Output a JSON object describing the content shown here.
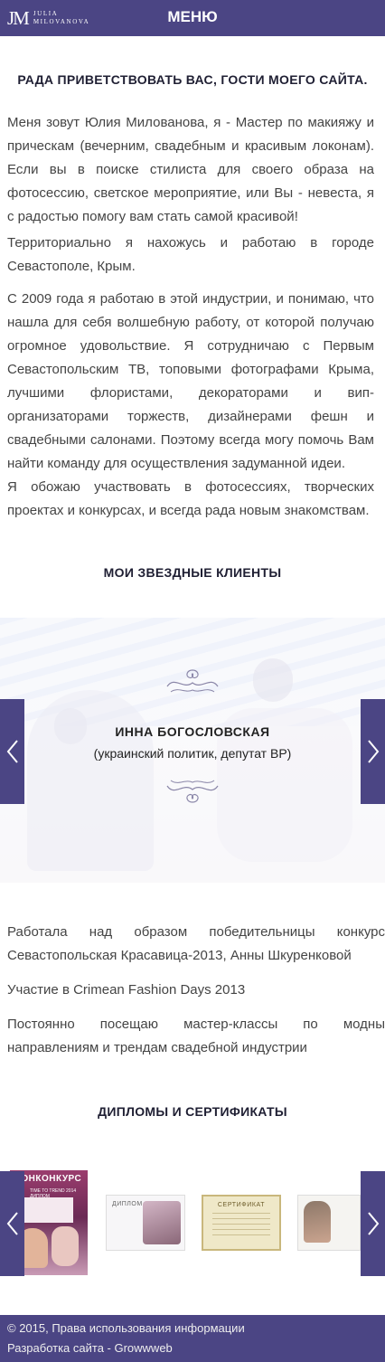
{
  "header": {
    "logo_mark": "JM",
    "logo_line1": "JULIA",
    "logo_line2": "MILOVANOVA",
    "menu_label": "МЕНЮ"
  },
  "welcome": {
    "title": "РАДА ПРИВЕТСТВОВАТЬ ВАС, ГОСТИ МОЕГО САЙТА.",
    "paragraphs": [
      "Меня зовут Юлия Милованова, я - Мастер по макияжу и прическам (вечерним, свадебным и красивым локонам). Если вы в поиске стилиста для своего образа на фотосессию, светское мероприятие, или Вы - невеста, я с радостью помогу вам стать самой красивой!",
      "Территориально я нахожусь и работаю в городе Севастополе, Крым.",
      "С 2009 года я работаю в этой индустрии, и понимаю, что нашла для себя волшебную работу, от которой получаю огромное удовольствие. Я сотрудничаю с Первым Севастопольским ТВ, топовыми фотографами Крыма, лучшими флористами, декораторами и вип-организаторами торжеств, дизайнерами фешн и свадебными салонами. Поэтому всегда могу помочь Вам найти команду для осуществления задуманной идеи.",
      "Я обожаю участвовать в фотосессиях, творческих проектах и конкурсах, и всегда рада новым знакомствам."
    ]
  },
  "clients": {
    "title": "МОИ ЗВЕЗДНЫЕ КЛИЕНТЫ",
    "slide": {
      "name": "ИННА БОГОСЛОВСКАЯ",
      "role": "(украинский политик, депутат ВР)"
    },
    "prev_icon": "chevron-left-icon",
    "next_icon": "chevron-right-icon"
  },
  "achievements": [
    "Работала над образом победительницы конкурс Севастопольская Красавица-2013, Анны Шкуренковой",
    "Участие в Crimean Fashion Days 2013",
    "Постоянно посещаю мастер-классы по модны направлениям и трендам свадебной индустрии"
  ],
  "diplomas": {
    "title": "ДИПЛОМЫ И СЕРТИФИКАТЫ",
    "items": [
      {
        "label": "ТОНКОНКУРС",
        "sub": "TIME TO TREND 2014 ДИПЛОМ"
      },
      {
        "label": "ДИПЛОМ"
      },
      {
        "label": "СЕРТИФИКАТ"
      },
      {
        "label": ""
      }
    ]
  },
  "footer": {
    "copyright": "© 2015, Права использования информации",
    "dev": "Разработка сайта - Growwweb"
  },
  "colors": {
    "brand": "#4b4584",
    "text": "#444444",
    "heading": "#1f1f33"
  }
}
